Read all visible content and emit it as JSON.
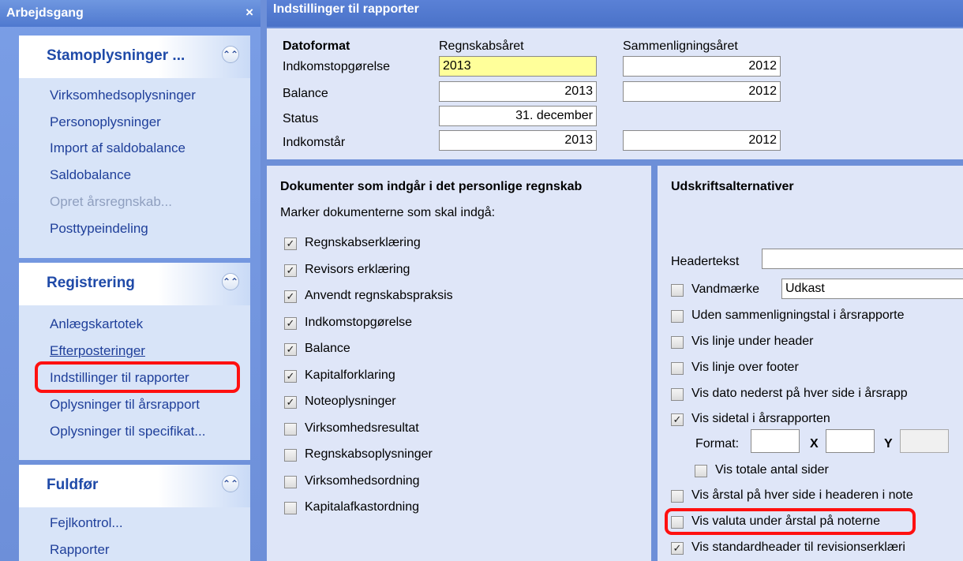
{
  "left": {
    "title": "Arbejdsgang",
    "close": "×",
    "groups": [
      {
        "title": "Stamoplysninger ...",
        "chevron": "«",
        "items": [
          "Virksomhedsoplysninger",
          "Personoplysninger",
          "Import af saldobalance",
          "Saldobalance",
          "Opret årsregnskab...",
          "Posttypeindeling"
        ]
      },
      {
        "title": "Registrering",
        "chevron": "«",
        "items": [
          "Anlægskartotek",
          "Efterposteringer",
          "Indstillinger til rapporter",
          "Oplysninger til årsrapport",
          "Oplysninger til specifikat..."
        ]
      },
      {
        "title": "Fuldfør",
        "chevron": "«",
        "items": [
          "Fejlkontrol...",
          "Rapporter"
        ]
      }
    ]
  },
  "main": {
    "title": "Indstillinger til rapporter",
    "dates": {
      "heading": "Datoformat",
      "col1": "Regnskabsåret",
      "col2": "Sammenligningsåret",
      "rows": [
        {
          "label": "Indkomstopgørelse",
          "v1": "2013",
          "v2": "2012"
        },
        {
          "label": "Balance",
          "v1": "2013",
          "v2": "2012"
        },
        {
          "label": "Status",
          "v1": "31. december",
          "v2": ""
        },
        {
          "label": "Indkomstår",
          "v1": "2013",
          "v2": "2012"
        }
      ]
    },
    "documents": {
      "heading": "Dokumenter som indgår i det personlige regnskab",
      "sub": "Marker dokumenterne som skal indgå:",
      "items": [
        {
          "label": "Regnskabserklæring",
          "checked": true
        },
        {
          "label": "Revisors erklæring",
          "checked": true
        },
        {
          "label": "Anvendt regnskabspraksis",
          "checked": true
        },
        {
          "label": "Indkomstopgørelse",
          "checked": true
        },
        {
          "label": "Balance",
          "checked": true
        },
        {
          "label": "Kapitalforklaring",
          "checked": true
        },
        {
          "label": "Noteoplysninger",
          "checked": true
        },
        {
          "label": "Virksomhedsresultat",
          "checked": false
        },
        {
          "label": "Regnskabsoplysninger",
          "checked": false
        },
        {
          "label": "Virksomhedsordning",
          "checked": false
        },
        {
          "label": "Kapitalafkastordning",
          "checked": false
        }
      ]
    },
    "print": {
      "heading": "Udskriftsalternativer",
      "headertext_label": "Headertekst",
      "headertext_value": "",
      "watermark_label": "Vandmærke",
      "watermark_value": "Udkast",
      "format_label": "Format:",
      "x_label": "X",
      "y_label": "Y",
      "options": [
        "Uden sammenligningstal i årsrapporte",
        "Vis linje under header",
        "Vis linje over footer",
        "Vis dato nederst på hver side i årsrapp",
        "Vis sidetal i årsrapporten",
        "Vis totale antal sider",
        "Vis årstal på hver side i headeren i note",
        "Vis valuta under årstal på noterne",
        "Vis standardheader til revisionserklæri"
      ],
      "checked": {
        "vandmaerke": false,
        "uden": false,
        "linje_under": false,
        "linje_over": false,
        "dato": false,
        "sidetal": true,
        "totale": false,
        "aarstal": false,
        "valuta": false,
        "standardheader": true
      }
    }
  }
}
